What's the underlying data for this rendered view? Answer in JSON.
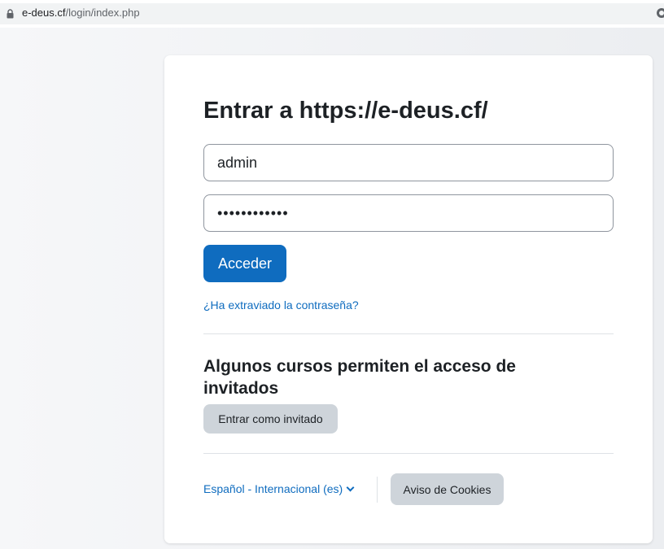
{
  "browser": {
    "url_host": "e-deus.cf",
    "url_path": "/login/index.php"
  },
  "login": {
    "title": "Entrar a https://e-deus.cf/",
    "username_value": "admin",
    "password_value": "••••••••••••",
    "submit_label": "Acceder",
    "forgot_password_label": "¿Ha extraviado la contraseña?"
  },
  "guest": {
    "heading": "Algunos cursos permiten el acceso de invitados",
    "button_label": "Entrar como invitado"
  },
  "footer": {
    "language_label": "Español - Internacional (es)",
    "cookies_label": "Aviso de Cookies"
  },
  "colors": {
    "primary": "#0f6cbf",
    "secondary_button": "#ced4da",
    "text": "#1d2125"
  },
  "icons": [
    "lock-icon",
    "close-icon",
    "chevron-down-icon"
  ]
}
